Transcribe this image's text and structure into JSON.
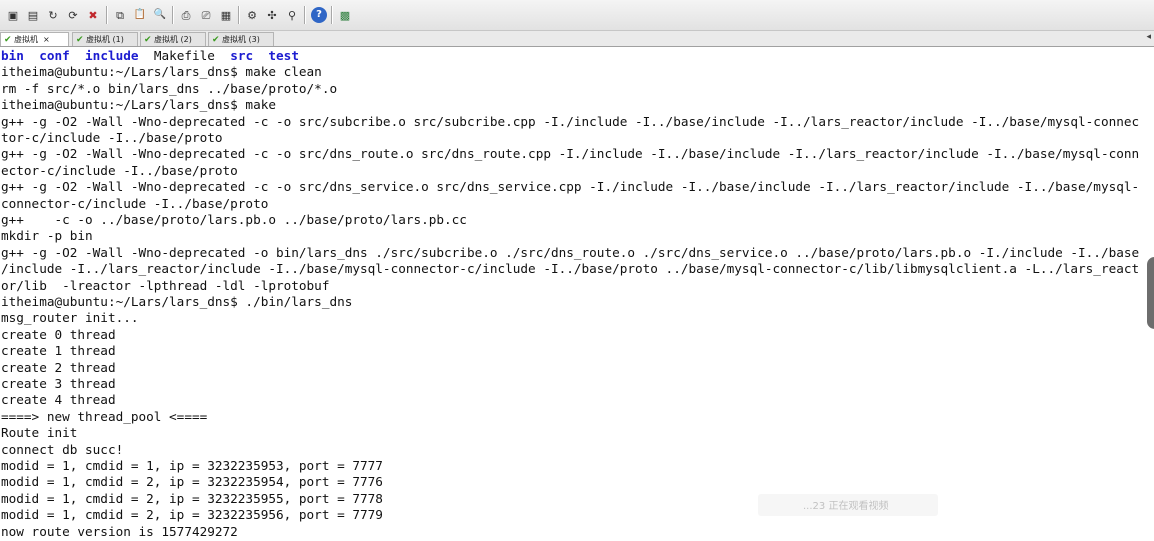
{
  "toolbar": {
    "buttons": [
      {
        "name": "new-session-icon",
        "glyph": "▣"
      },
      {
        "name": "open-session-icon",
        "glyph": "▤"
      },
      {
        "name": "reconnect-icon",
        "glyph": "↻"
      },
      {
        "name": "reconnect-all-icon",
        "glyph": "⟳"
      },
      {
        "name": "disconnect-icon",
        "glyph": "✖"
      },
      {
        "name": "copy-icon",
        "glyph": "⧉"
      },
      {
        "name": "paste-icon",
        "glyph": "📋"
      },
      {
        "name": "find-icon",
        "glyph": "🔍"
      },
      {
        "name": "print-icon",
        "glyph": "⎙"
      },
      {
        "name": "print-setup-icon",
        "glyph": "⎚"
      },
      {
        "name": "print-preview-icon",
        "glyph": "▦"
      },
      {
        "name": "session-options-icon",
        "glyph": "⚙"
      },
      {
        "name": "key-map-icon",
        "glyph": "✣"
      },
      {
        "name": "keyboard-map-icon",
        "glyph": "⚲"
      },
      {
        "name": "help-icon",
        "glyph": "?"
      },
      {
        "name": "screen-icon",
        "glyph": "▩"
      }
    ]
  },
  "tabs": [
    {
      "label": "虚拟机",
      "close": "×"
    },
    {
      "label": "虚拟机 (1)"
    },
    {
      "label": "虚拟机 (2)"
    },
    {
      "label": "虚拟机 (3)"
    }
  ],
  "tab_scroll": "◂",
  "terminal": {
    "dirs": [
      "bin",
      "conf",
      "include",
      "Makefile",
      "src",
      "test"
    ],
    "lines": [
      "itheima@ubuntu:~/Lars/lars_dns$ make clean",
      "rm -f src/*.o bin/lars_dns ../base/proto/*.o",
      "itheima@ubuntu:~/Lars/lars_dns$ make",
      "g++ -g -O2 -Wall -Wno-deprecated -c -o src/subcribe.o src/subcribe.cpp -I./include -I../base/include -I../lars_reactor/include -I../base/mysql-connec",
      "tor-c/include -I../base/proto",
      "g++ -g -O2 -Wall -Wno-deprecated -c -o src/dns_route.o src/dns_route.cpp -I./include -I../base/include -I../lars_reactor/include -I../base/mysql-conn",
      "ector-c/include -I../base/proto",
      "g++ -g -O2 -Wall -Wno-deprecated -c -o src/dns_service.o src/dns_service.cpp -I./include -I../base/include -I../lars_reactor/include -I../base/mysql-",
      "connector-c/include -I../base/proto",
      "g++    -c -o ../base/proto/lars.pb.o ../base/proto/lars.pb.cc",
      "mkdir -p bin",
      "g++ -g -O2 -Wall -Wno-deprecated -o bin/lars_dns ./src/subcribe.o ./src/dns_route.o ./src/dns_service.o ../base/proto/lars.pb.o -I./include -I../base",
      "/include -I../lars_reactor/include -I../base/mysql-connector-c/include -I../base/proto ../base/mysql-connector-c/lib/libmysqlclient.a -L../lars_react",
      "or/lib  -lreactor -lpthread -ldl -lprotobuf",
      "itheima@ubuntu:~/Lars/lars_dns$ ./bin/lars_dns",
      "msg_router init...",
      "create 0 thread",
      "create 1 thread",
      "create 2 thread",
      "create 3 thread",
      "create 4 thread",
      "====> new thread_pool <====",
      "Route init",
      "connect db succ!",
      "modid = 1, cmdid = 1, ip = 3232235953, port = 7777",
      "modid = 1, cmdid = 2, ip = 3232235954, port = 7776",
      "modid = 1, cmdid = 2, ip = 3232235955, port = 7778",
      "modid = 1, cmdid = 2, ip = 3232235956, port = 7779",
      "now route version is 1577429272"
    ]
  },
  "watermark": "...23 正在观看视频",
  "colors": {
    "directory": "#1c1cd0",
    "text": "#111111",
    "tab_check": "#3a9a1f"
  }
}
